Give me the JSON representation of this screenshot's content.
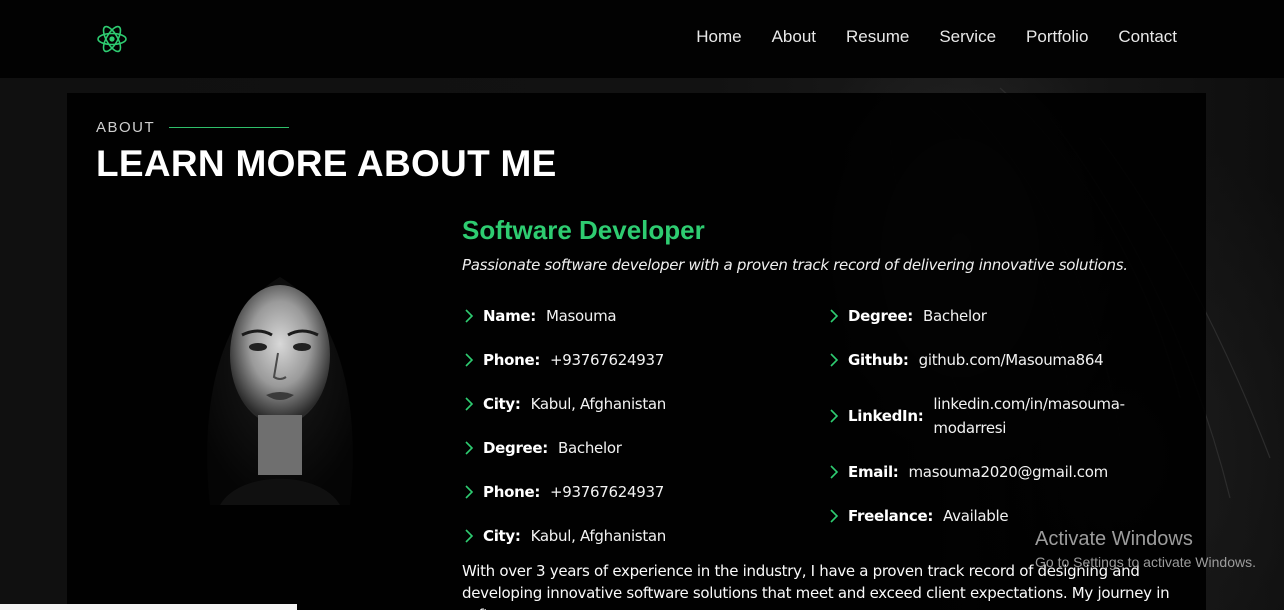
{
  "nav": {
    "logo_icon": "react-atom-icon",
    "items": [
      "Home",
      "About",
      "Resume",
      "Service",
      "Portfolio",
      "Contact"
    ]
  },
  "about": {
    "section_label": "ABOUT",
    "title": "LEARN MORE ABOUT ME",
    "role": "Software Developer",
    "tagline": "Passionate software developer with a proven track record of delivering innovative solutions.",
    "left_info": [
      {
        "key": "Name:",
        "value": "Masouma"
      },
      {
        "key": "Phone:",
        "value": "+93767624937"
      },
      {
        "key": "City:",
        "value": "Kabul, Afghanistan"
      },
      {
        "key": "Degree:",
        "value": "Bachelor"
      },
      {
        "key": "Phone:",
        "value": "+93767624937"
      },
      {
        "key": "City:",
        "value": "Kabul, Afghanistan"
      }
    ],
    "right_info": [
      {
        "key": "Degree:",
        "value": "Bachelor"
      },
      {
        "key": "Github:",
        "value": "github.com/Masouma864"
      },
      {
        "key": "LinkedIn:",
        "value": "linkedin.com/in/masouma-modarresi"
      },
      {
        "key": "Email:",
        "value": "masouma2020@gmail.com"
      },
      {
        "key": "Freelance:",
        "value": "Available"
      }
    ],
    "bio": "With over 3 years of experience in the industry, I have a proven track record of designing and developing innovative software solutions that meet and exceed client expectations. My journey in software"
  },
  "watermark": {
    "title": "Activate Windows",
    "subtitle": "Go to Settings to activate Windows."
  },
  "colors": {
    "accent": "#2ecc71",
    "nav_bg": "#020202",
    "panel_bg": "#000000"
  }
}
